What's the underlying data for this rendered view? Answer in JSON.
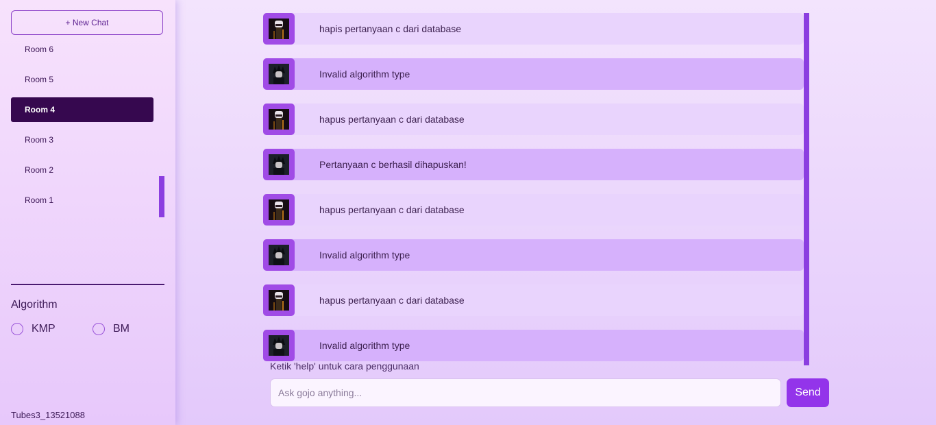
{
  "sidebar": {
    "new_chat_label": "+ New Chat",
    "rooms": [
      {
        "label": "Room 6",
        "active": false
      },
      {
        "label": "Room 5",
        "active": false
      },
      {
        "label": "Room 4",
        "active": true
      },
      {
        "label": "Room 3",
        "active": false
      },
      {
        "label": "Room 2",
        "active": false
      },
      {
        "label": "Room 1",
        "active": false
      }
    ],
    "algorithm_title": "Algorithm",
    "algorithms": [
      {
        "label": "KMP",
        "selected": false
      },
      {
        "label": "BM",
        "selected": false
      }
    ],
    "footer": "Tubes3_13521088"
  },
  "chat": {
    "messages": [
      {
        "sender": "user",
        "avatar": "gojo-avatar-icon",
        "text": "hapis pertanyaan c dari database"
      },
      {
        "sender": "bot",
        "avatar": "megumi-avatar-icon",
        "text": "Invalid algorithm type"
      },
      {
        "sender": "user",
        "avatar": "gojo-avatar-icon",
        "text": "hapus pertanyaan c dari database"
      },
      {
        "sender": "bot",
        "avatar": "megumi-avatar-icon",
        "text": "Pertanyaan c berhasil dihapuskan!"
      },
      {
        "sender": "user",
        "avatar": "gojo-avatar-icon",
        "text": "hapus pertanyaan c dari database"
      },
      {
        "sender": "bot",
        "avatar": "megumi-avatar-icon",
        "text": "Invalid algorithm type"
      },
      {
        "sender": "user",
        "avatar": "gojo-avatar-icon",
        "text": "hapus pertanyaan c dari database"
      },
      {
        "sender": "bot",
        "avatar": "megumi-avatar-icon",
        "text": "Invalid algorithm type"
      }
    ],
    "help_text": "Ketik 'help' untuk cara penggunaan",
    "input_placeholder": "Ask gojo anything...",
    "input_value": "",
    "send_label": "Send"
  },
  "colors": {
    "accent": "#9334ea",
    "active_room": "#36084f",
    "bot_bubble": "#d6b1fc",
    "user_bubble": "#e9d4fd",
    "scrollbar": "#8b3ee0"
  }
}
